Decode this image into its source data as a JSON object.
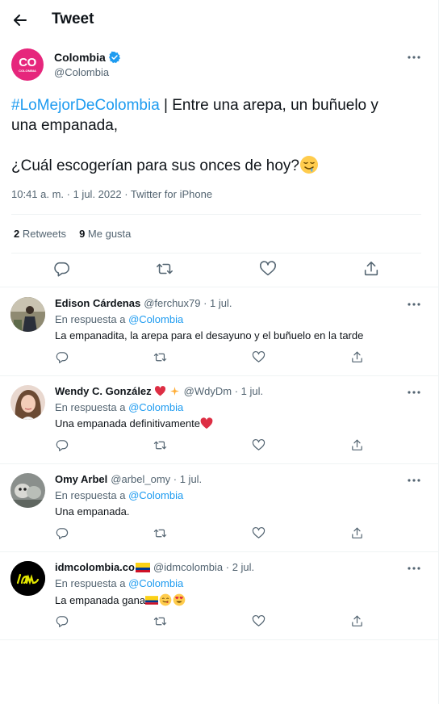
{
  "header": {
    "title": "Tweet"
  },
  "tweet": {
    "author_name": "Colombia",
    "author_handle": "@Colombia",
    "hashtag": "#LoMejorDeColombia",
    "text_line1_rest": " | Entre una arepa, un buñuelo y",
    "text_line2": "una empanada,",
    "text_line3": "¿Cuál escogerían para sus onces de hoy?",
    "meta": "10:41 a. m. · 1 jul. 2022 · Twitter for iPhone",
    "stats": {
      "retweets_count": "2",
      "retweets_label": "Retweets",
      "likes_count": "9",
      "likes_label": "Me gusta"
    }
  },
  "replies": [
    {
      "name": "Edison Cárdenas",
      "handle": "@ferchux79 · 1 jul.",
      "reply_to_prefix": "En respuesta a",
      "reply_to": "@Colombia",
      "text": "La empanadita, la arepa para el desayuno y el buñuelo en la tarde"
    },
    {
      "name": "Wendy C. González",
      "handle": "@WdyDm · 1 jul.",
      "reply_to_prefix": "En respuesta a",
      "reply_to": "@Colombia",
      "text": "Una empanada definitivamente"
    },
    {
      "name": "Omy Arbel",
      "handle": "@arbel_omy · 1 jul.",
      "reply_to_prefix": "En respuesta a",
      "reply_to": "@Colombia",
      "text": "Una empanada."
    },
    {
      "name": "idmcolombia.co",
      "handle": "@idmcolombia · 2 jul.",
      "reply_to_prefix": "En respuesta a",
      "reply_to": "@Colombia",
      "text": "La empanada gana"
    }
  ],
  "colors": {
    "accent": "#1d9bf0",
    "secondary_text": "#536471",
    "text": "#0f1419",
    "divider": "#eff3f4",
    "avatar_colombia": "#e6267c"
  },
  "icons": [
    "back-arrow-icon",
    "verified-badge-icon",
    "more-icon",
    "reply-icon",
    "retweet-icon",
    "like-icon",
    "share-icon"
  ]
}
